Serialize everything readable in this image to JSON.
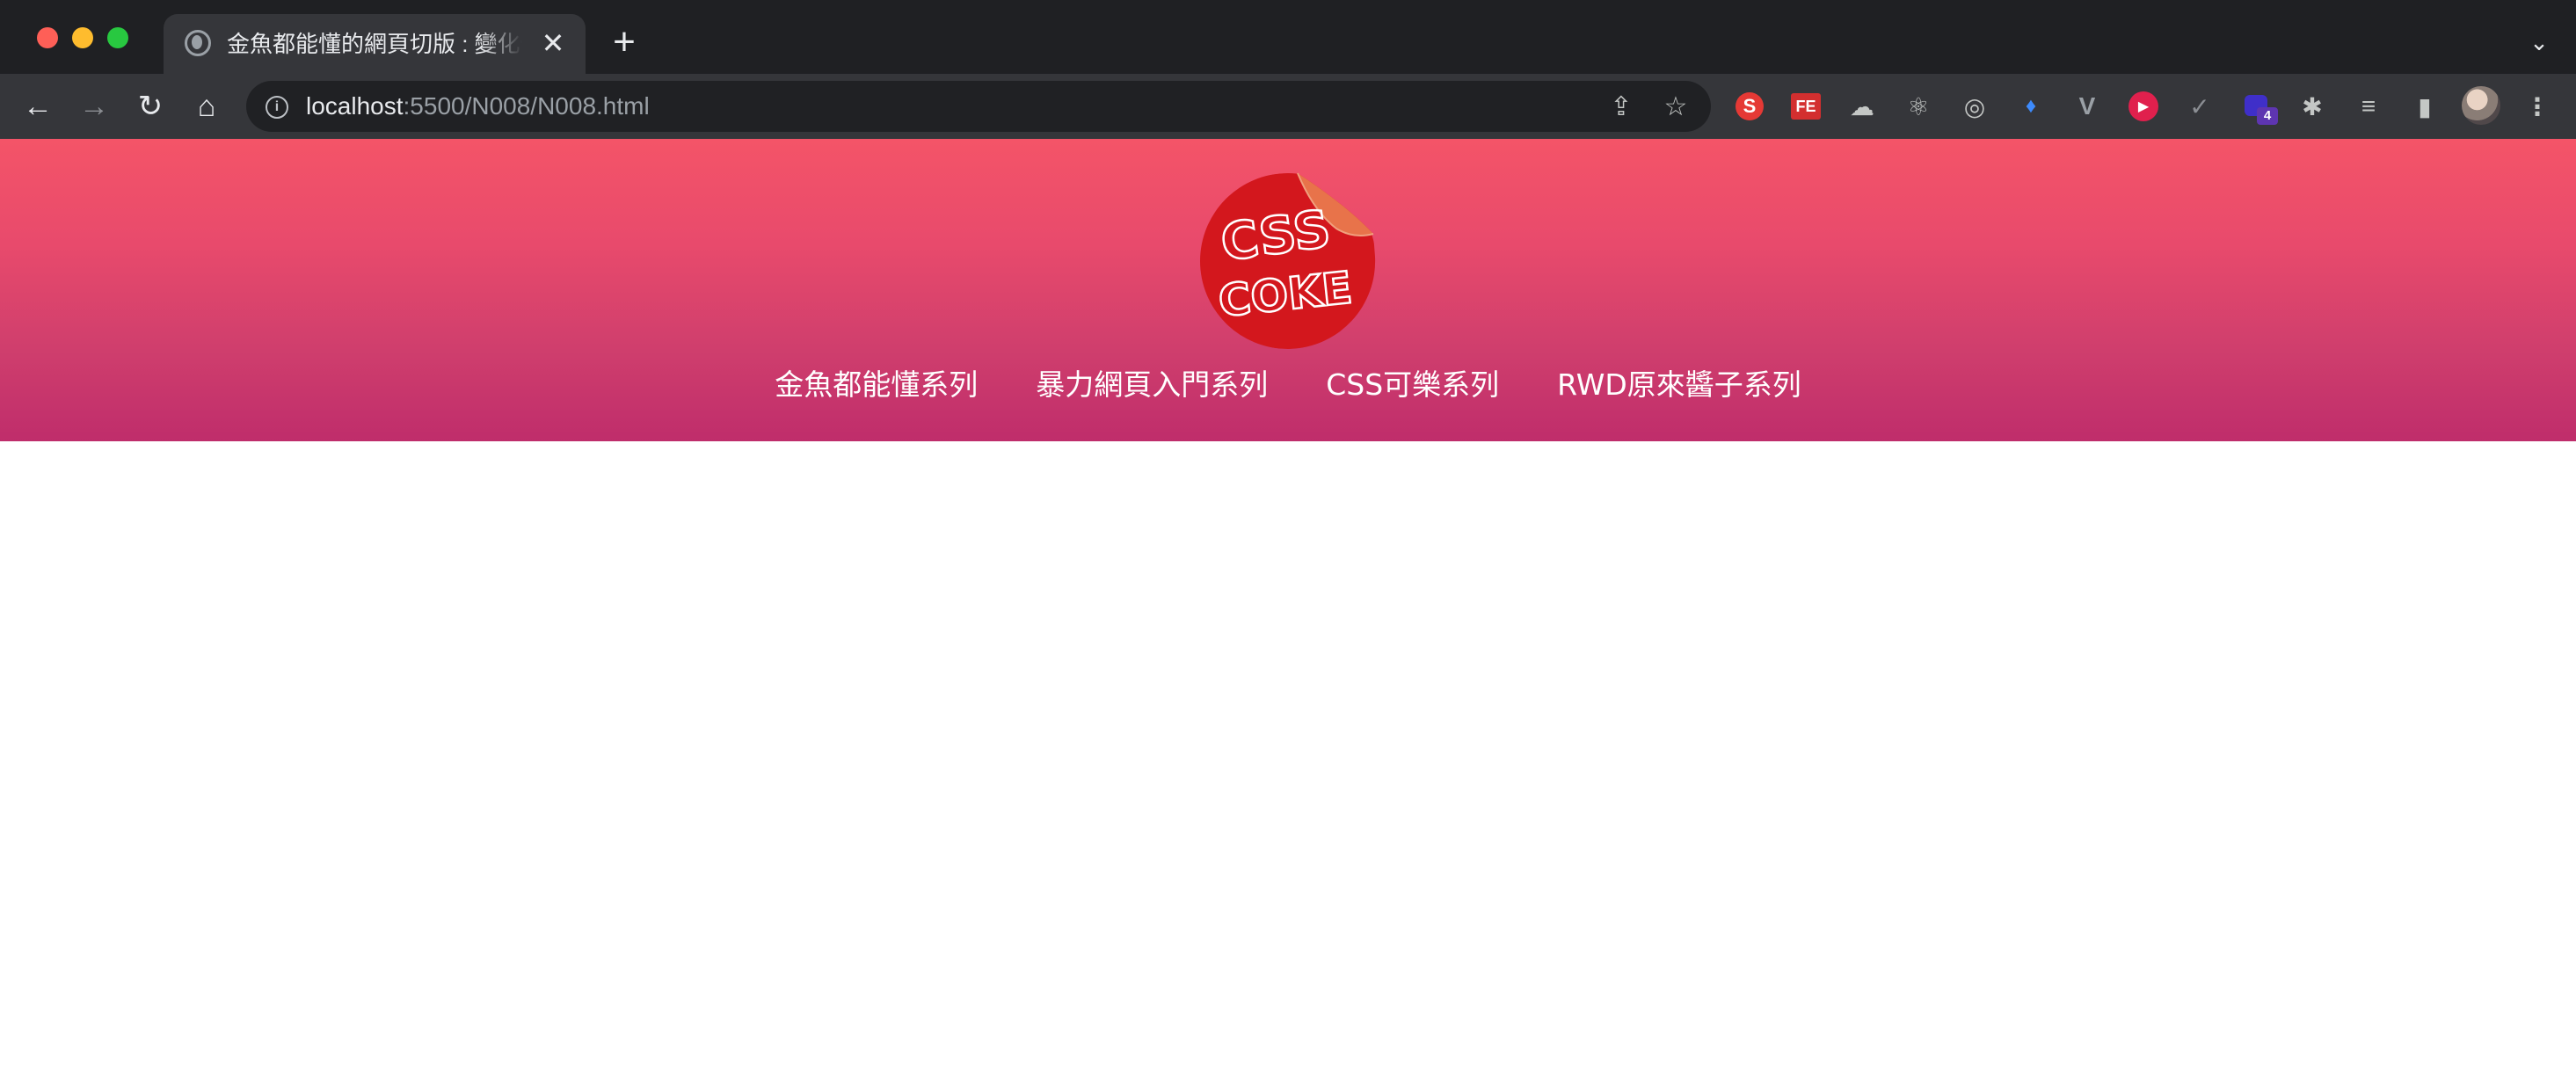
{
  "browser": {
    "tab": {
      "title": "金魚都能懂的網頁切版 : 變化你的",
      "close_label": "✕"
    },
    "new_tab_label": "+",
    "tab_menu_label": "⌄",
    "toolbar": {
      "back_label": "←",
      "forward_label": "→",
      "reload_label": "↻",
      "home_label": "⌂"
    },
    "omnibox": {
      "info_label": "i",
      "url_host": "localhost",
      "url_path": ":5500/N008/N008.html",
      "share_label": "⇪",
      "bookmark_label": "☆"
    },
    "extensions": {
      "s_label": "S",
      "fe_label": "FE",
      "cloud_label": "☁",
      "react_label": "⚛",
      "target_label": "◎",
      "gem_label": "♦",
      "vue_label": "V",
      "play_label": "▶",
      "check_label": "✓",
      "stack_badge": "4",
      "puzzle_label": "✱",
      "media_label": "≡",
      "sidepanel_label": "▮",
      "menu_label": "⋮"
    }
  },
  "site": {
    "logo": {
      "line1": "CSS",
      "line2": "COKE"
    },
    "nav": [
      {
        "label": "金魚都能懂系列"
      },
      {
        "label": "暴力網頁入門系列"
      },
      {
        "label": "CSS可樂系列"
      },
      {
        "label": "RWD原來醬子系列"
      }
    ]
  },
  "colors": {
    "header_top": "#f45468",
    "header_bottom": "#bf2d6b",
    "logo_red": "#d3171d",
    "logo_peel": "#e8734a"
  }
}
